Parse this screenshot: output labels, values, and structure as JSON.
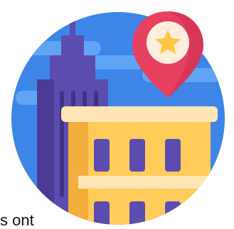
{
  "icon": {
    "name": "city-location-icon",
    "colors": {
      "sky": "#3D86E8",
      "cloud": "#5FA4F5",
      "tower": "#5D4CB0",
      "tower_shade": "#4A3C96",
      "tower_window": "#3F3285",
      "building": "#FFCC5A",
      "building_shade": "#F4AE3B",
      "building_cap": "#FFE6B4",
      "building_window": "#5D4CB0",
      "pin": "#E8405F",
      "pin_shade": "#C9304E",
      "pin_face": "#FFEEDD",
      "star": "#FFC845"
    }
  },
  "cut_text": "s ont"
}
